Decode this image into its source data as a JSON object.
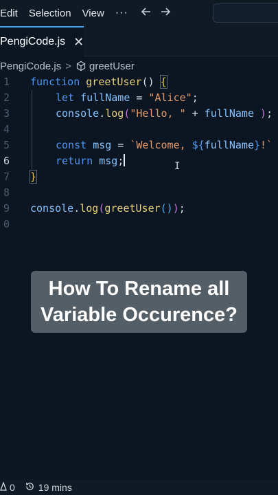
{
  "menu": {
    "items": [
      "Edit",
      "Selection",
      "View"
    ],
    "more": "···",
    "back_icon": "arrow-left-icon",
    "forward_icon": "arrow-right-icon"
  },
  "tab": {
    "label": "PengiCode.js",
    "close": "✕"
  },
  "breadcrumb": {
    "file": "PengiCode.js",
    "separator": ">",
    "symbol": "greetUser"
  },
  "editor": {
    "line_numbers": [
      "1",
      "2",
      "3",
      "4",
      "5",
      "6",
      "7",
      "8",
      "9",
      "0"
    ],
    "active_line": "6",
    "lines": [
      {
        "ln": "1",
        "tokens": [
          [
            "kw",
            "function "
          ],
          [
            "fn",
            "greetUser"
          ],
          [
            "pn",
            "() "
          ],
          [
            "br",
            "{"
          ]
        ]
      },
      {
        "ln": "2",
        "tokens": [
          [
            "kw",
            "let "
          ],
          [
            "var",
            "fullName"
          ],
          [
            "pn",
            " = "
          ],
          [
            "str",
            "\"Alice\""
          ],
          [
            "pn",
            ";"
          ]
        ]
      },
      {
        "ln": "3",
        "tokens": [
          [
            "var",
            "console"
          ],
          [
            "pn",
            "."
          ],
          [
            "fn",
            "log"
          ],
          [
            "br2",
            "("
          ],
          [
            "str",
            "\"Hello, \""
          ],
          [
            "pn",
            " + "
          ],
          [
            "var",
            "fullName"
          ],
          [
            "pn",
            " "
          ],
          [
            "br2",
            ")"
          ],
          [
            "pn",
            ";"
          ]
        ]
      },
      {
        "ln": "4",
        "tokens": []
      },
      {
        "ln": "5",
        "tokens": [
          [
            "kw",
            "const "
          ],
          [
            "var",
            "msg"
          ],
          [
            "pn",
            " = "
          ],
          [
            "str",
            "`Welcome, "
          ],
          [
            "kw",
            "${"
          ],
          [
            "var",
            "fullName"
          ],
          [
            "kw",
            "}"
          ],
          [
            "str",
            "!`"
          ]
        ]
      },
      {
        "ln": "6",
        "tokens": [
          [
            "kw",
            "return "
          ],
          [
            "var",
            "msg"
          ],
          [
            "pn",
            ";"
          ]
        ]
      },
      {
        "ln": "7",
        "tokens": [
          [
            "br",
            "}"
          ]
        ]
      },
      {
        "ln": "8",
        "tokens": []
      },
      {
        "ln": "9",
        "tokens": [
          [
            "var",
            "console"
          ],
          [
            "pn",
            "."
          ],
          [
            "fn",
            "log"
          ],
          [
            "br2",
            "("
          ],
          [
            "fn",
            "greetUser"
          ],
          [
            "br3",
            "()"
          ],
          [
            "br2",
            ")"
          ],
          [
            "pn",
            ";"
          ]
        ]
      },
      {
        "ln": "0",
        "tokens": []
      }
    ]
  },
  "caption": {
    "line1": "How To Rename all",
    "line2": "Variable Occurence?"
  },
  "status": {
    "errors": "0",
    "time": "19 mins"
  }
}
